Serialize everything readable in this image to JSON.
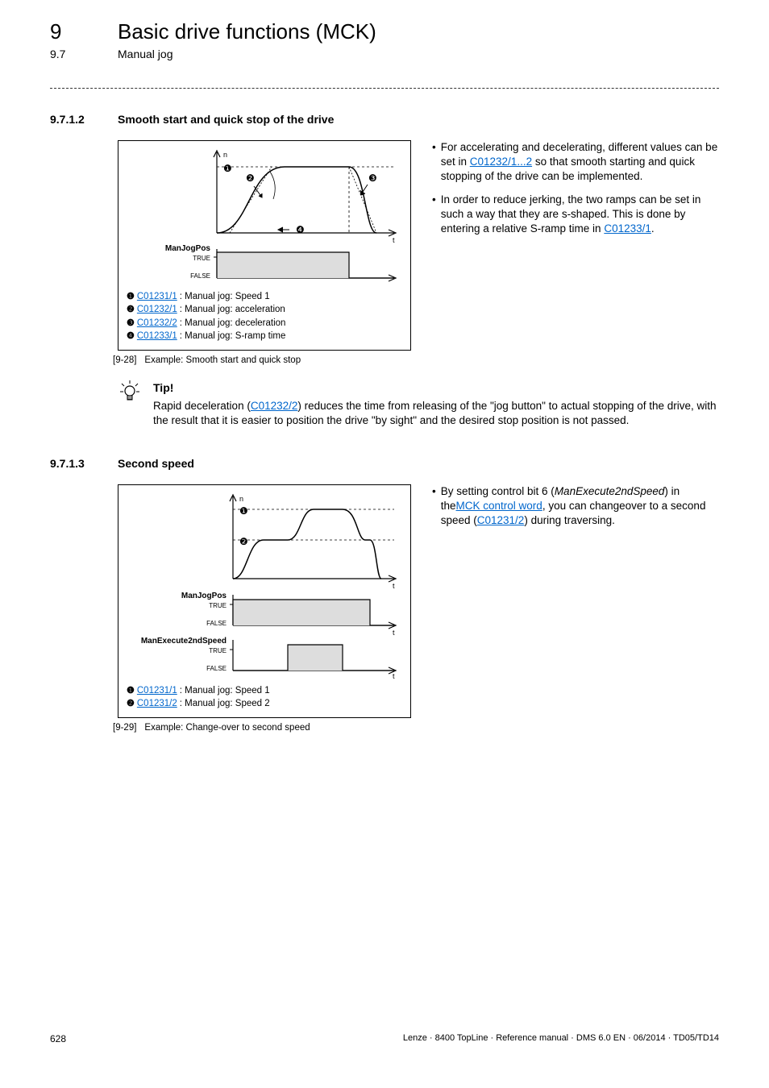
{
  "header": {
    "chapter_num": "9",
    "chapter_title": "Basic drive functions (MCK)",
    "sub_num": "9.7",
    "sub_title": "Manual jog"
  },
  "section_9712": {
    "num": "9.7.1.2",
    "title": "Smooth start and quick stop of the drive",
    "fig": {
      "legend": [
        {
          "dot": "❶",
          "link": "C01231/1",
          "desc": ": Manual jog: Speed 1"
        },
        {
          "dot": "❷",
          "link": "C01232/1",
          "desc": ": Manual jog: acceleration"
        },
        {
          "dot": "❸",
          "link": "C01232/2",
          "desc": ": Manual jog: deceleration"
        },
        {
          "dot": "❹",
          "link": "C01233/1",
          "desc": ": Manual jog: S-ramp time"
        }
      ],
      "caption_tag": "[9-28]",
      "caption_text": "Example: Smooth start and quick stop",
      "labels": {
        "n": "n",
        "jogpos": "ManJogPos",
        "true": "TRUE",
        "false": "FALSE",
        "t": "t"
      },
      "dots": {
        "d1": "❶",
        "d2": "❷",
        "d3": "❸",
        "d4": "❹"
      }
    },
    "bullets": [
      {
        "pre": "For accelerating and decelerating, different values can be set in ",
        "link": "C01232/1...2",
        "post": " so that smooth starting and quick stopping of the drive can be implemented."
      },
      {
        "pre": "In order to reduce jerking, the two ramps can be set in such a way that they are s-shaped. This is done by entering a relative S-ramp time in ",
        "link": "C01233/1",
        "post": "."
      }
    ],
    "tip": {
      "title": "Tip!",
      "pre": "Rapid deceleration (",
      "link": "C01232/2",
      "post": ") reduces the time from releasing of the \"jog button\" to actual stopping of the drive, with the result that it is easier to position the drive \"by sight\" and the desired stop position is not passed."
    }
  },
  "section_9713": {
    "num": "9.7.1.3",
    "title": "Second speed",
    "fig": {
      "legend": [
        {
          "dot": "❶",
          "link": "C01231/1",
          "desc": ": Manual jog: Speed 1"
        },
        {
          "dot": "❷",
          "link": "C01231/2",
          "desc": ": Manual jog: Speed 2"
        }
      ],
      "caption_tag": "[9-29]",
      "caption_text": "Example: Change-over to second speed",
      "labels": {
        "n": "n",
        "jogpos": "ManJogPos",
        "exec2": "ManExecute2ndSpeed",
        "true": "TRUE",
        "false": "FALSE",
        "t": "t"
      },
      "dots": {
        "d1": "❶",
        "d2": "❷"
      }
    },
    "bullet": {
      "pre": "By setting control bit 6 (",
      "italic": "ManExecute2ndSpeed",
      "mid1": ") in the",
      "link1": "MCK control word",
      "mid2": ", you can changeover to a second speed (",
      "link2": "C01231/2",
      "post": ") during traversing."
    }
  },
  "footer": {
    "page": "628",
    "right": "Lenze · 8400 TopLine · Reference manual · DMS 6.0 EN · 06/2014 · TD05/TD14"
  }
}
